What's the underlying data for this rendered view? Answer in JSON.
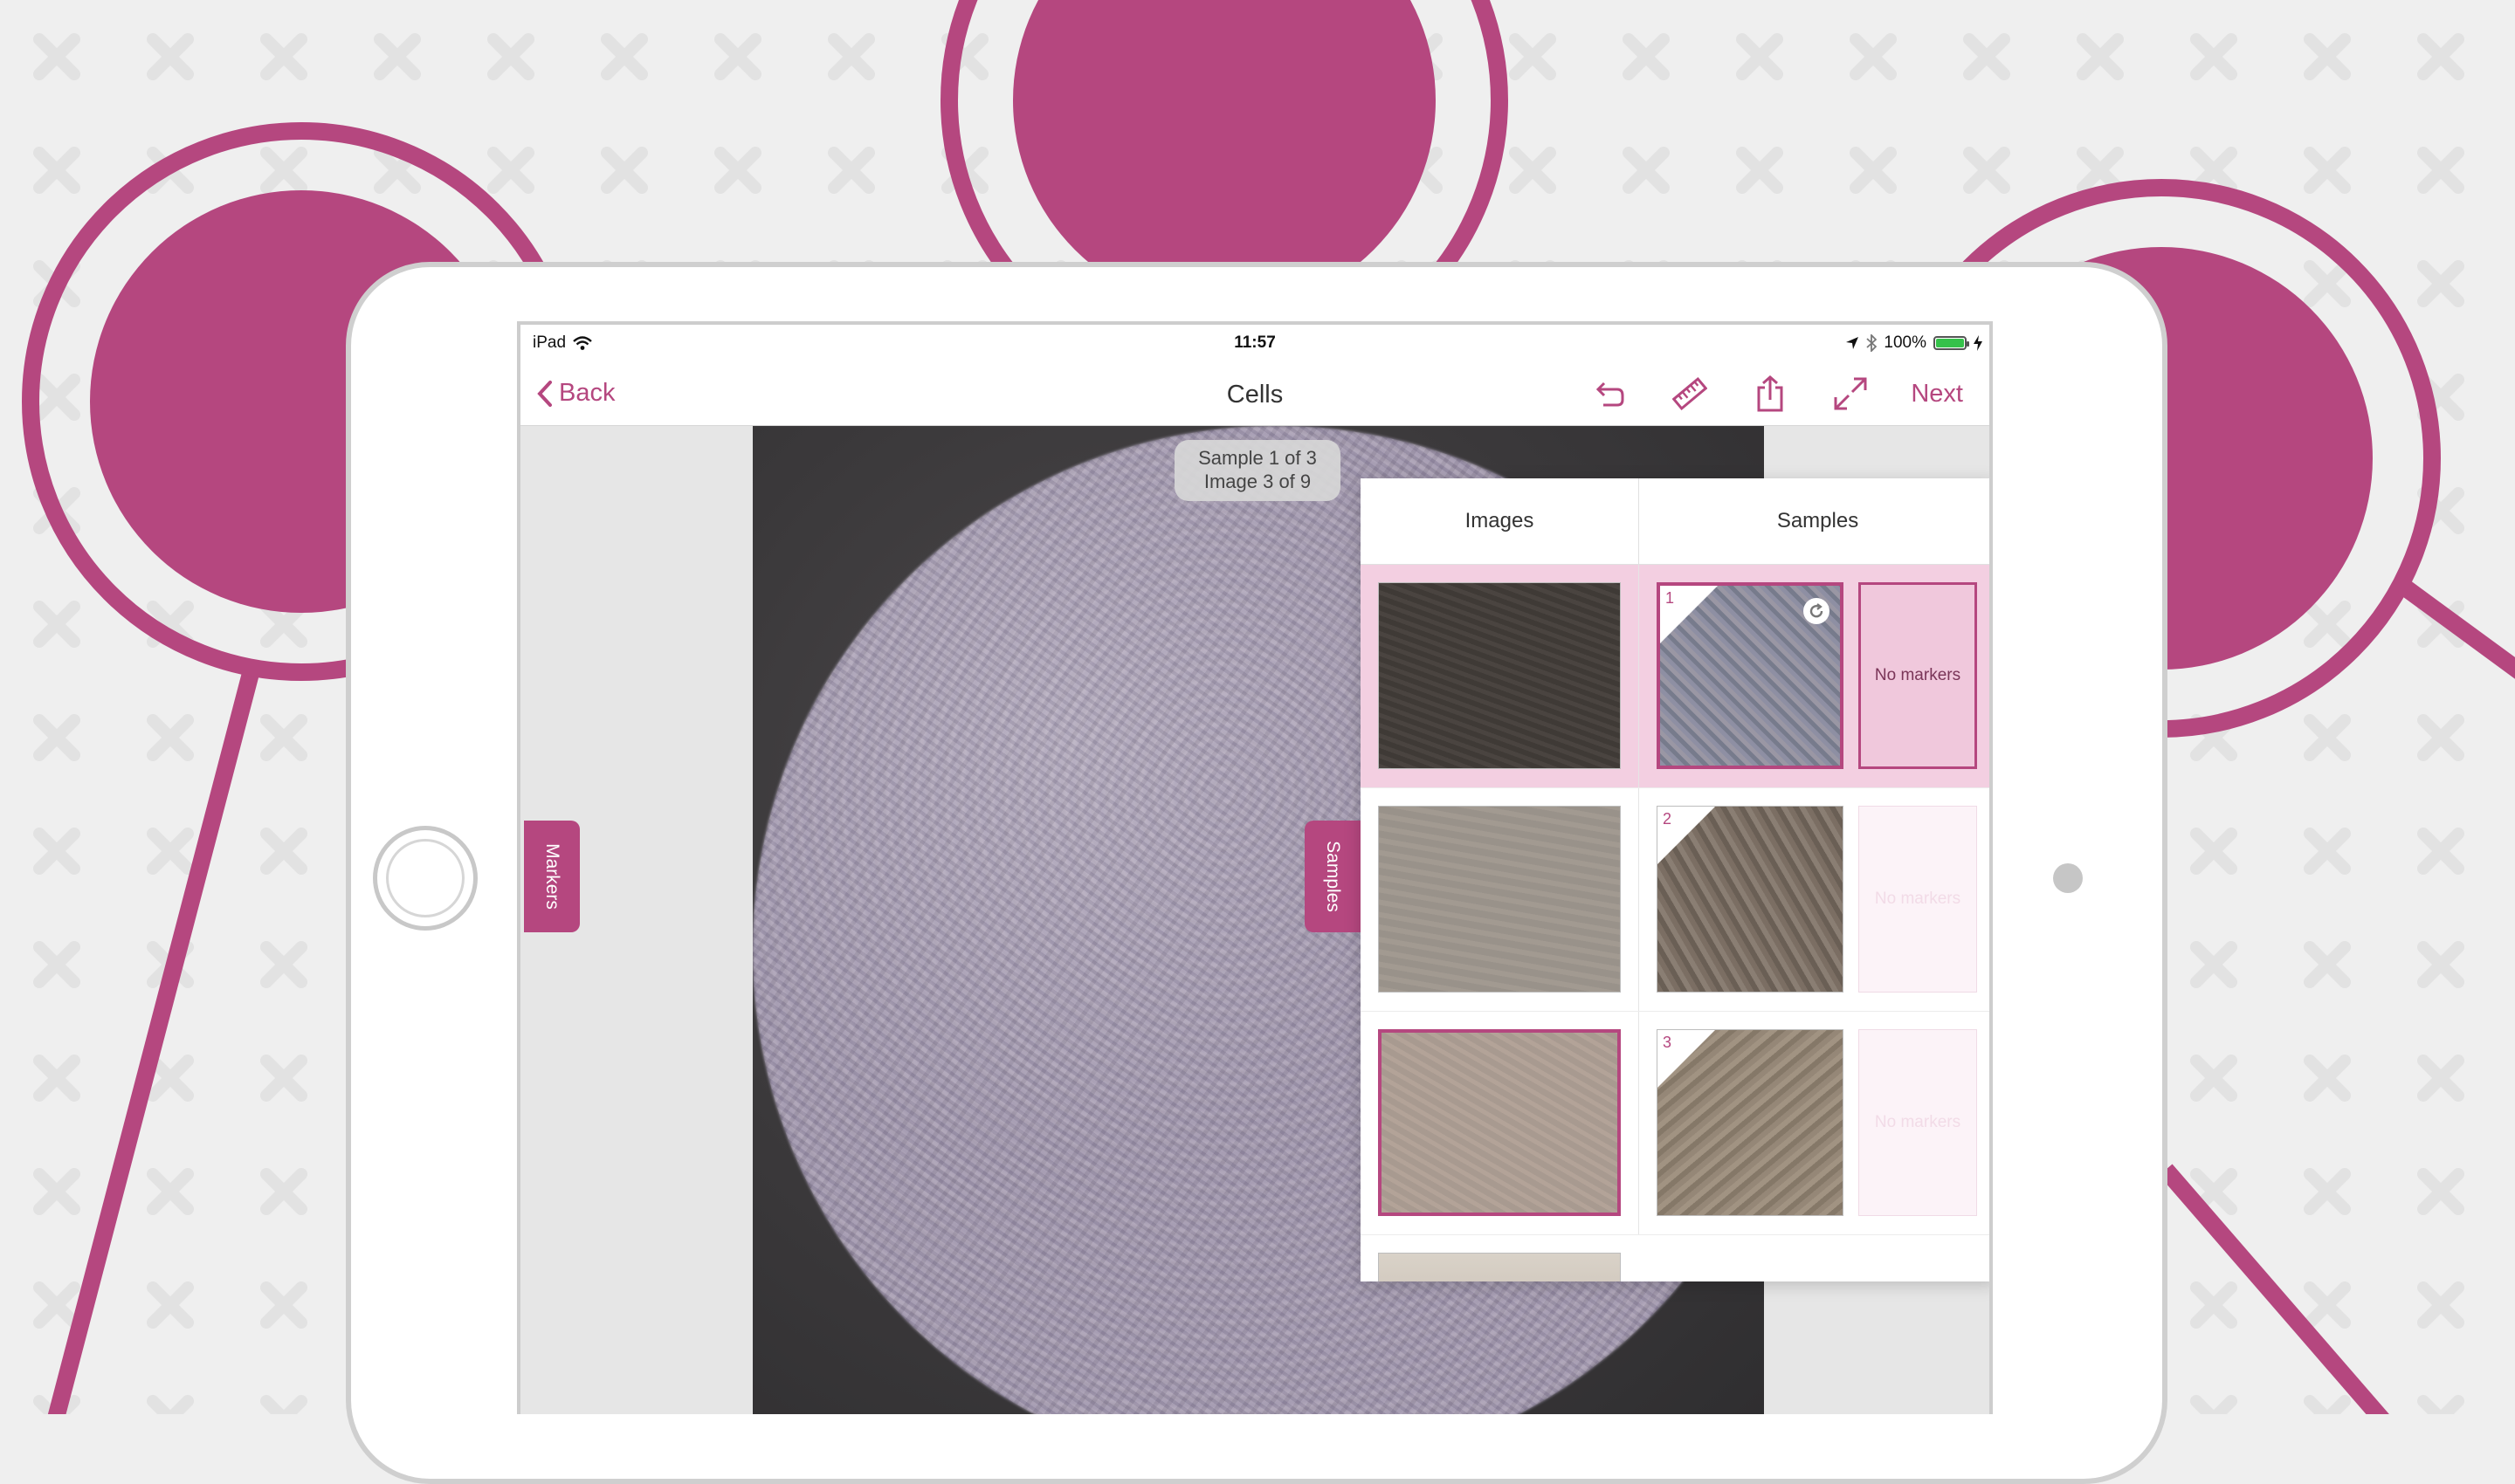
{
  "colors": {
    "accent": "#b5477f",
    "selected_row": "#f3cfe1"
  },
  "statusbar": {
    "device": "iPad",
    "time": "11:57",
    "battery": "100%",
    "battery_level": 1.0
  },
  "navbar": {
    "back_label": "Back",
    "title": "Cells",
    "next_label": "Next",
    "tools": [
      "undo-icon",
      "ruler-icon",
      "share-icon",
      "expand-icon"
    ]
  },
  "badge": {
    "sample": "Sample 1 of 3",
    "image": "Image 3 of 9"
  },
  "tabs": {
    "markers": "Markers",
    "samples": "Samples"
  },
  "panel": {
    "headers": {
      "images": "Images",
      "samples": "Samples"
    },
    "rows": [
      {
        "sample_number": "1",
        "marker_text": "No markers",
        "selected": true
      },
      {
        "sample_number": "2",
        "marker_text": "No markers",
        "selected": false
      },
      {
        "sample_number": "3",
        "marker_text": "No markers",
        "selected": false
      }
    ]
  }
}
